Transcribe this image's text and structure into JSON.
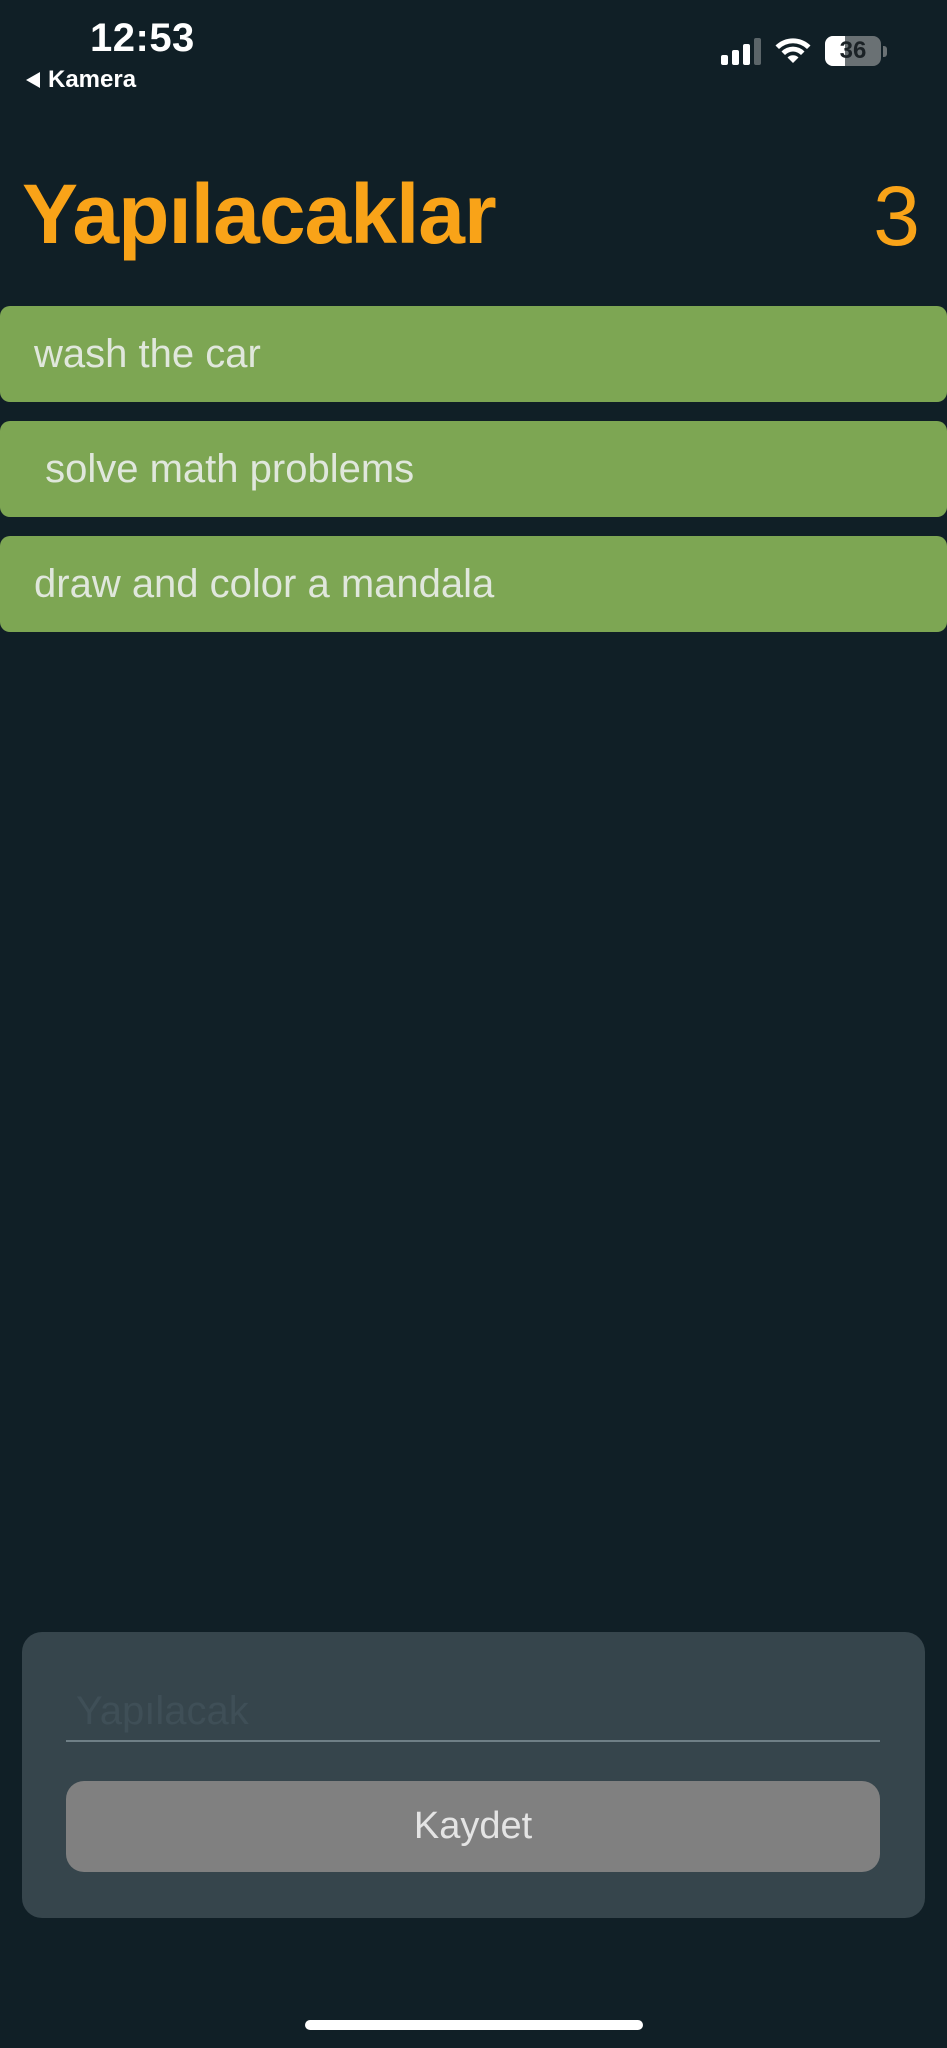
{
  "status_bar": {
    "time": "12:53",
    "back_label": "Kamera",
    "battery_text": "36",
    "battery_level": 0.36,
    "signal_bars_active": 3,
    "signal_bars_total": 4
  },
  "header": {
    "title": "Yapılacaklar",
    "count": "3"
  },
  "tasks": [
    {
      "label": "wash the car"
    },
    {
      "label": " solve math problems"
    },
    {
      "label": "draw and color a mandala"
    }
  ],
  "input": {
    "placeholder": "Yapılacak",
    "value": "",
    "save_label": "Kaydet"
  },
  "colors": {
    "background": "#101f26",
    "accent": "#f9a318",
    "task_item": "#7da653",
    "panel": "#36454c",
    "button": "#808080"
  }
}
